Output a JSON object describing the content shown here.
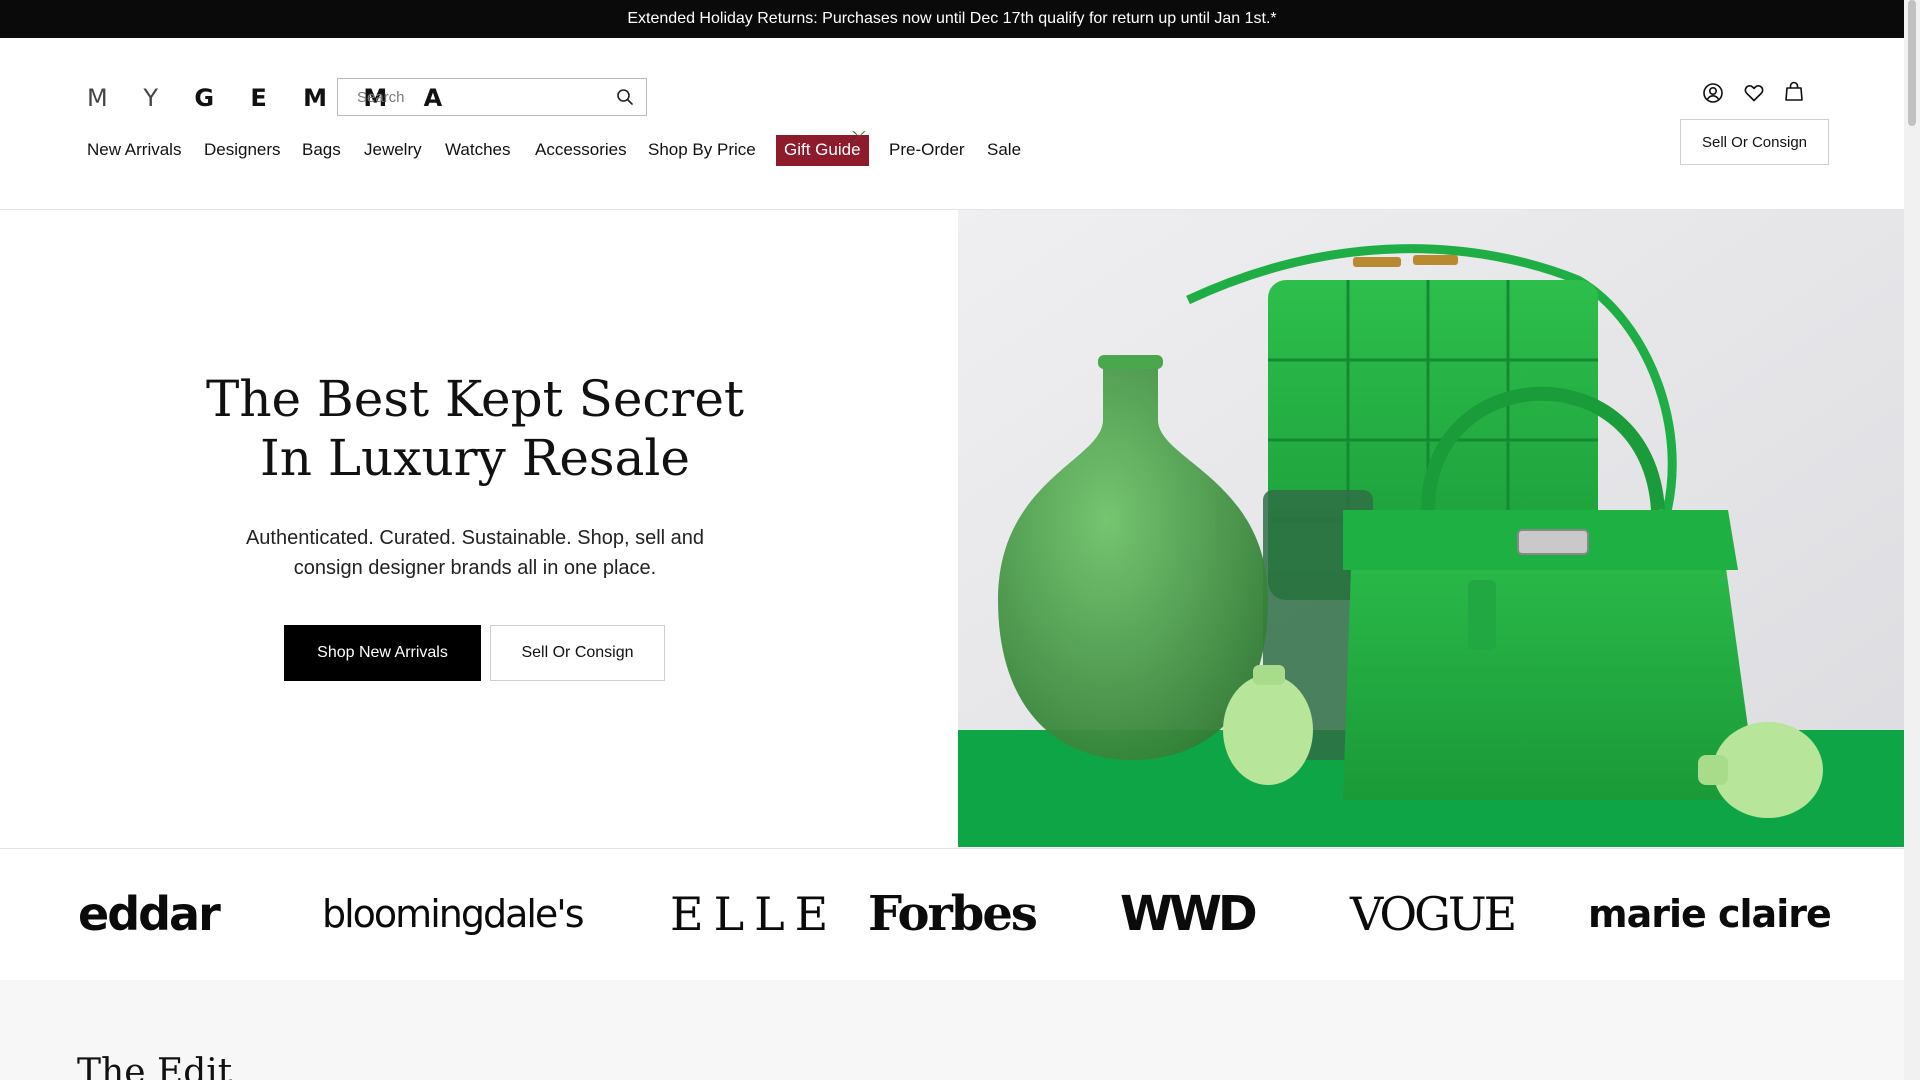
{
  "announcement": "Extended Holiday Returns: Purchases now until Dec 17th qualify for return up until Jan 1st.*",
  "brand": {
    "logo_thin": "M Y",
    "logo_bold": "G E M M A"
  },
  "search": {
    "placeholder": "Search"
  },
  "header": {
    "sell_label": "Sell Or Consign"
  },
  "nav": {
    "new_arrivals": "New Arrivals",
    "designers": "Designers",
    "bags": "Bags",
    "jewelry": "Jewelry",
    "watches": "Watches",
    "accessories": "Accessories",
    "shop_by_price": "Shop By Price",
    "gift_guide": "Gift Guide",
    "pre_order": "Pre-Order",
    "sale": "Sale"
  },
  "hero": {
    "title_line1": "The Best Kept Secret",
    "title_line2": "In Luxury Resale",
    "subtitle_line1": "Authenticated. Curated. Sustainable. Shop, sell and",
    "subtitle_line2": "consign designer brands all in one place.",
    "primary_cta": "Shop New Arrivals",
    "secondary_cta": "Sell Or Consign"
  },
  "press": {
    "p1": "eddar",
    "p2": "bloomingdale's",
    "p3": "ELLE",
    "p4": "Forbes",
    "p5": "WWD",
    "p6": "VOGUE",
    "p7": "marie claire"
  },
  "sections": {
    "edit_title": "The Edit"
  },
  "colors": {
    "announcement_bg": "#0a0a0a",
    "gift_guide_bg": "#8e1b2c",
    "primary_button": "#000000",
    "hero_green": "#1faa3f"
  },
  "icons": {
    "search": "search-icon",
    "account": "account-icon",
    "wishlist": "heart-icon",
    "bag": "shopping-bag-icon"
  }
}
